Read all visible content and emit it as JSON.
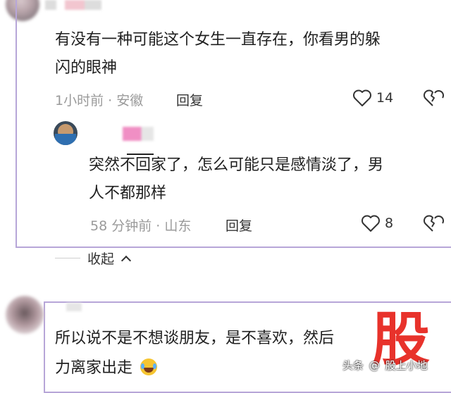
{
  "comment1": {
    "text_line1": "有没有一种可能这个女生一直存在，你看男的躲",
    "text_line2": "闪的眼神",
    "time_location": "1小时前 · 安徽",
    "reply_label": "回复",
    "like_count": "14"
  },
  "reply1": {
    "text_line1": "突然不回家了，怎么可能只是感情淡了，男",
    "text_line2": "人不都那样",
    "time_location": "58 分钟前 · 山东",
    "reply_label": "回复",
    "like_count": "8"
  },
  "collapse": {
    "label": "收起"
  },
  "comment2": {
    "text_line1": "所以说不是不想谈朋友，是不喜欢，然后",
    "text_line2": "力离家出走"
  },
  "watermark": {
    "big_char": "股",
    "source": "头条",
    "author": "股上小地"
  },
  "colors": {
    "frame": "#b7a6d8",
    "meta": "#9a9a9a",
    "watermark_red": "#e8322b"
  }
}
